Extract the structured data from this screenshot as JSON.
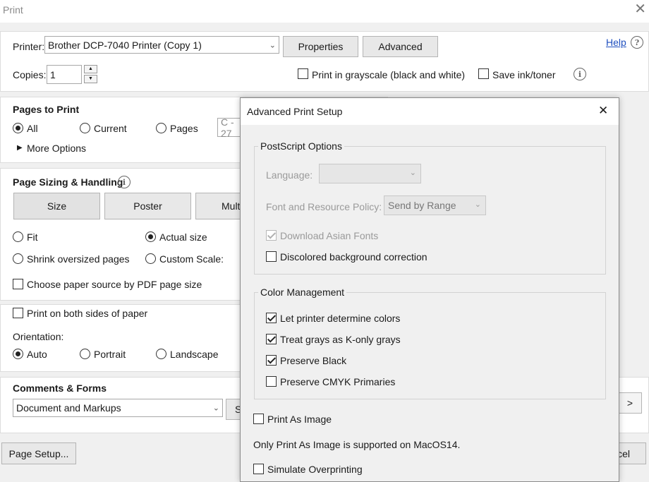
{
  "window": {
    "title": "Print",
    "close": "✕"
  },
  "header": {
    "printer_label": "Printer:",
    "printer_value": "Brother DCP-7040 Printer (Copy 1)",
    "properties_label": "Properties",
    "advanced_label": "Advanced",
    "help_label": "Help",
    "copies_label": "Copies:",
    "copies_value": "1",
    "grayscale_label": "Print in grayscale (black and white)",
    "save_ink_label": "Save ink/toner"
  },
  "pages_to_print": {
    "title": "Pages to Print",
    "all_label": "All",
    "current_label": "Current",
    "pages_label": "Pages",
    "pages_value": "C - 27",
    "more_options_label": "More Options"
  },
  "sizing": {
    "title": "Page Sizing & Handling",
    "size_tab": "Size",
    "poster_tab": "Poster",
    "multiple_tab": "Mult",
    "fit_label": "Fit",
    "actual_size_label": "Actual size",
    "shrink_label": "Shrink oversized pages",
    "custom_scale_label": "Custom Scale:",
    "paper_source_label": "Choose paper source by PDF page size",
    "both_sides_label": "Print on both sides of paper",
    "orientation_label": "Orientation:",
    "auto_label": "Auto",
    "portrait_label": "Portrait",
    "landscape_label": "Landscape"
  },
  "comments": {
    "title": "Comments & Forms",
    "value": "Document and Markups",
    "summarize_label": "S"
  },
  "footer": {
    "page_setup_label": "Page Setup...",
    "next_label": ">",
    "cancel_partial": "cel"
  },
  "advanced_dialog": {
    "title": "Advanced Print Setup",
    "close": "✕",
    "postscript": {
      "legend": "PostScript Options",
      "language_label": "Language:",
      "language_value": "",
      "font_policy_label": "Font and Resource Policy:",
      "font_policy_value": "Send by Range",
      "download_asian_label": "Download Asian Fonts",
      "discolored_label": "Discolored background correction"
    },
    "color": {
      "legend": "Color Management",
      "let_printer_label": "Let printer determine colors",
      "treat_grays_label": "Treat grays as K-only grays",
      "preserve_black_label": "Preserve Black",
      "preserve_cmyk_label": "Preserve CMYK Primaries"
    },
    "print_as_image_label": "Print As Image",
    "macos_note": "Only Print As Image is supported on MacOS14.",
    "simulate_label": "Simulate Overprinting"
  }
}
